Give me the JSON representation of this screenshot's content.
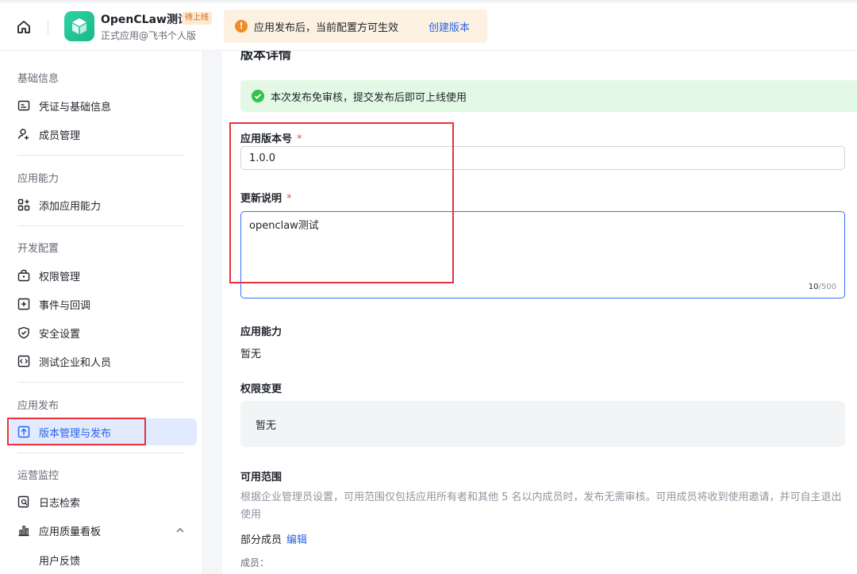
{
  "header": {
    "app_name": "OpenCLaw测试",
    "status_badge": "待上线",
    "app_subtitle": "正式应用@飞书个人版",
    "notice_text": "应用发布后，当前配置方可生效",
    "notice_link": "创建版本"
  },
  "sidebar": {
    "sections": [
      {
        "title": "基础信息",
        "items": [
          {
            "label": "凭证与基础信息",
            "icon": "id-card-icon"
          },
          {
            "label": "成员管理",
            "icon": "user-add-icon"
          }
        ]
      },
      {
        "title": "应用能力",
        "items": [
          {
            "label": "添加应用能力",
            "icon": "add-grid-icon"
          }
        ]
      },
      {
        "title": "开发配置",
        "items": [
          {
            "label": "权限管理",
            "icon": "lock-icon"
          },
          {
            "label": "事件与回调",
            "icon": "plus-square-icon"
          },
          {
            "label": "安全设置",
            "icon": "shield-icon"
          },
          {
            "label": "测试企业和人员",
            "icon": "code-icon"
          }
        ]
      },
      {
        "title": "应用发布",
        "items": [
          {
            "label": "版本管理与发布",
            "icon": "upload-icon",
            "active": true
          }
        ]
      },
      {
        "title": "运营监控",
        "items": [
          {
            "label": "日志检索",
            "icon": "log-search-icon"
          },
          {
            "label": "应用质量看板",
            "icon": "bar-chart-icon",
            "expanded": true
          },
          {
            "label": "用户反馈",
            "sub": true
          }
        ]
      }
    ]
  },
  "main": {
    "title": "版本详情",
    "success_notice": "本次发布免审核，提交发布后即可上线使用",
    "version_label": "应用版本号",
    "version_value": "1.0.0",
    "notes_label": "更新说明",
    "notes_value": "openclaw测试",
    "notes_count": "10",
    "notes_max": "/500",
    "required_mark": "*",
    "capability_label": "应用能力",
    "capability_value": "暂无",
    "permission_label": "权限变更",
    "permission_value": "暂无",
    "scope_label": "可用范围",
    "scope_desc": "根据企业管理员设置，可用范围仅包括应用所有者和其他 5 名以内成员时，发布无需审核。可用成员将收到使用邀请，并可自主退出使用",
    "scope_value": "部分成员",
    "scope_edit": "编辑",
    "members_label": "成员："
  },
  "colors": {
    "accent": "#2b63e3",
    "active_bg": "#e1eaff",
    "highlight_red": "#e8313a",
    "success_bg": "#e4f8e6",
    "notice_bg": "#fdf1e2"
  }
}
